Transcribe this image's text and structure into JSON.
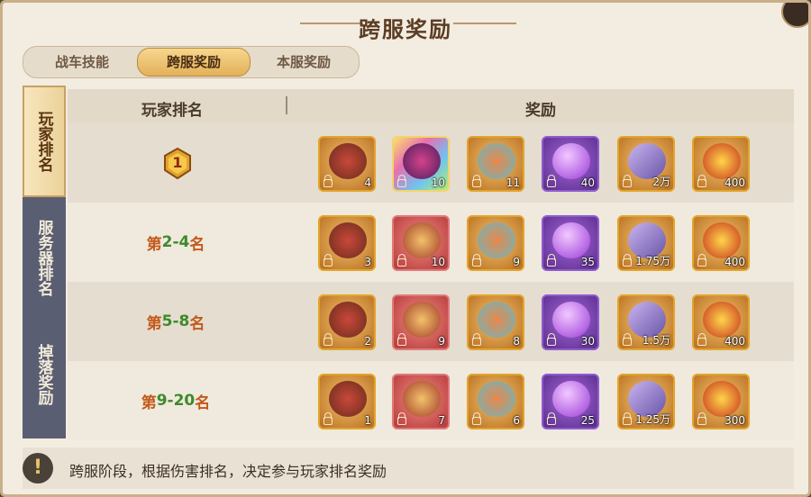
{
  "title": "跨服奖励",
  "tabs": [
    {
      "label": "战车技能",
      "active": false
    },
    {
      "label": "跨服奖励",
      "active": true
    },
    {
      "label": "本服奖励",
      "active": false
    }
  ],
  "side_tabs": [
    {
      "label": "玩家排名",
      "active": true
    },
    {
      "label": "服务器排名",
      "active": false
    },
    {
      "label": "掉落奖励",
      "active": false
    }
  ],
  "table": {
    "headers": {
      "rank": "玩家排名",
      "rewards": "奖励"
    },
    "rows": [
      {
        "rank_label": "1",
        "rank_is_medal": true,
        "rewards": [
          {
            "icon": "chariot-card",
            "count": "4"
          },
          {
            "icon": "dragon-card",
            "count": "10"
          },
          {
            "icon": "treasure-bag",
            "count": "11"
          },
          {
            "icon": "purple-orb",
            "count": "40"
          },
          {
            "icon": "skill-book",
            "count": "2万"
          },
          {
            "icon": "star-medal",
            "count": "400"
          }
        ]
      },
      {
        "rank_prefix": "第",
        "rank_range": "2-4",
        "rank_suffix": "名",
        "rewards": [
          {
            "icon": "chariot-card",
            "count": "3"
          },
          {
            "icon": "beast-card",
            "count": "10"
          },
          {
            "icon": "treasure-bag",
            "count": "9"
          },
          {
            "icon": "purple-orb",
            "count": "35"
          },
          {
            "icon": "skill-book",
            "count": "1.75万"
          },
          {
            "icon": "star-medal",
            "count": "400"
          }
        ]
      },
      {
        "rank_prefix": "第",
        "rank_range": "5-8",
        "rank_suffix": "名",
        "rewards": [
          {
            "icon": "chariot-card",
            "count": "2"
          },
          {
            "icon": "beast-card",
            "count": "9"
          },
          {
            "icon": "treasure-bag",
            "count": "8"
          },
          {
            "icon": "purple-orb",
            "count": "30"
          },
          {
            "icon": "skill-book",
            "count": "1.5万"
          },
          {
            "icon": "star-medal",
            "count": "400"
          }
        ]
      },
      {
        "rank_prefix": "第",
        "rank_range": "9-20",
        "rank_suffix": "名",
        "rewards": [
          {
            "icon": "chariot-card",
            "count": "1"
          },
          {
            "icon": "beast-card",
            "count": "7"
          },
          {
            "icon": "treasure-bag",
            "count": "6"
          },
          {
            "icon": "purple-orb",
            "count": "25"
          },
          {
            "icon": "skill-book",
            "count": "1.25万"
          },
          {
            "icon": "star-medal",
            "count": "300"
          }
        ]
      }
    ]
  },
  "footer": {
    "icon": "!",
    "text": "跨服阶段，根据伤害排名，决定参与玩家排名奖励"
  },
  "colors": {
    "rank_text": "#c25a1b",
    "rank_number": "#3e8a2a",
    "accent_gold": "#e3b05a"
  }
}
